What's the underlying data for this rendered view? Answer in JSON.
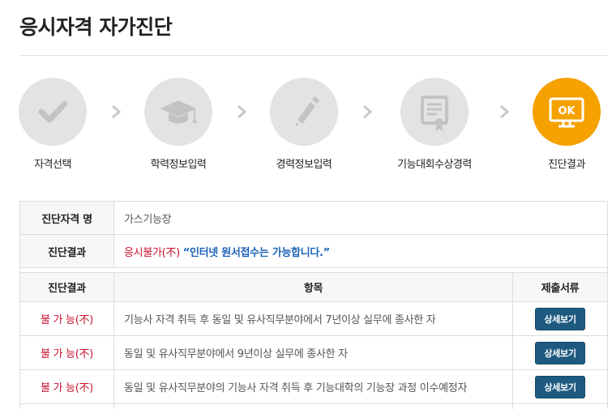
{
  "page": {
    "title": "응시자격 자가진단"
  },
  "steps": [
    {
      "label": "자격선택",
      "icon": "checkmark-icon",
      "active": false
    },
    {
      "label": "학력정보입력",
      "icon": "graduation-cap-icon",
      "active": false
    },
    {
      "label": "경력정보입력",
      "icon": "pencil-icon",
      "active": false
    },
    {
      "label": "기능대회수상경력",
      "icon": "certificate-icon",
      "active": false
    },
    {
      "label": "진단결과",
      "icon": "monitor-ok-icon",
      "icon_text": "OK",
      "active": true
    }
  ],
  "summary": {
    "qualification_label": "진단자격 명",
    "qualification_value": "가스기능장",
    "result_label": "진단결과",
    "result_status": "응시불가(不)",
    "result_message": "“인터넷 원서접수는 가능합니다.”"
  },
  "table": {
    "headers": [
      "진단결과",
      "항목",
      "제출서류"
    ],
    "rows": [
      {
        "result": "불 가 능(不)",
        "item": "기능사 자격 취득 후 동일 및 유사직무분야에서 7년이상 실무에 종사한 자",
        "button": "상세보기"
      },
      {
        "result": "불 가 능(不)",
        "item": "동일 및 유사직무분야에서 9년이상 실무에 종사한 자",
        "button": "상세보기"
      },
      {
        "result": "불 가 능(不)",
        "item": "동일 및 유사직무분야의 기능사 자격 취득 후 기능대학의 기능장 과정 이수예정자",
        "button": "상세보기"
      }
    ]
  },
  "colors": {
    "active_step": "#f5a100",
    "inactive_step": "#e3e3e3",
    "fail_text": "#c8102e",
    "message_text": "#1c63b8",
    "button_bg": "#1e5a80"
  }
}
